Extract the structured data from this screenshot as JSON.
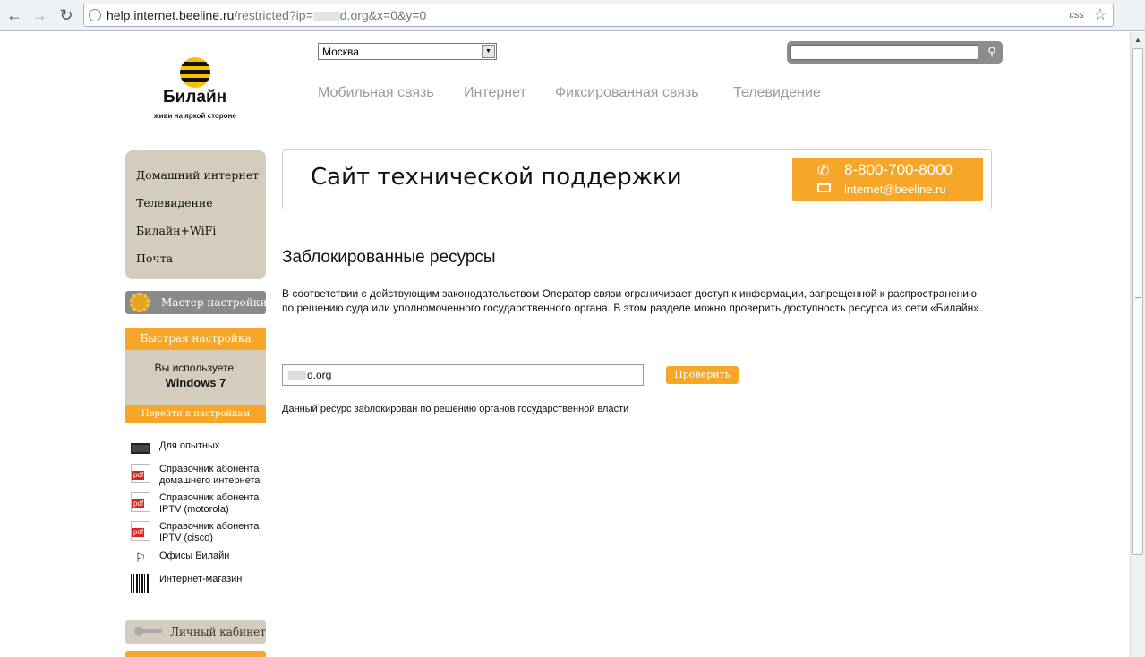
{
  "browser": {
    "url_host": "help.internet.beeline.ru",
    "url_path_1": "/restricted?ip=",
    "url_path_2": "d.org&x=0&y=0",
    "css_label": "css"
  },
  "header": {
    "logo_name": "Билайн",
    "logo_tagline": "живи на яркой стороне",
    "city": "Москва",
    "search_value": "",
    "nav": [
      "Мобильная связь",
      "Интернет",
      "Фиксированная связь",
      "Телевидение"
    ]
  },
  "sidebar": {
    "menu": [
      "Домашний интернет",
      "Телевидение",
      "Билайн+WiFi",
      "Почта"
    ],
    "master_label": "Мастер настройки",
    "quick": {
      "head": "Быстрая настройка",
      "using": "Вы используете:",
      "os": "Windows 7",
      "go": "Перейти к настройкам"
    },
    "links": [
      {
        "label": "Для опытных",
        "icon": "monitor-icon"
      },
      {
        "label": "Справочник абонента домашнего интернета",
        "icon": "pdf-icon"
      },
      {
        "label": "Справочник абонента IPTV (motorola)",
        "icon": "pdf-icon"
      },
      {
        "label": "Справочник абонента IPTV (cisco)",
        "icon": "pdf-icon"
      },
      {
        "label": "Офисы Билайн",
        "icon": "sign-icon"
      },
      {
        "label": "Интернет-магазин",
        "icon": "barcode-icon"
      }
    ],
    "pdf_badge": "pdf",
    "cabinet_label": "Личный кабинет"
  },
  "main": {
    "banner_title": "Сайт технической поддержки",
    "phone": "8-800-700-8000",
    "email": "internet@beeline.ru",
    "page_title": "Заблокированные ресурсы",
    "description": "В соответствии с действующим законодательством Оператор связи ограничивает доступ к информации, запрещенной к распространению по решению суда или уполномоченного государственного органа. В этом разделе можно проверить доступность ресурса из сети «Билайн».",
    "check_value": "d.org",
    "check_button": "Проверить",
    "result": "Данный ресурс заблокирован по решению органов государственной власти"
  },
  "colors": {
    "accent": "#f6a72a",
    "sidebar_bg": "#d4cdbd",
    "nav_link": "#9a9a9a"
  }
}
